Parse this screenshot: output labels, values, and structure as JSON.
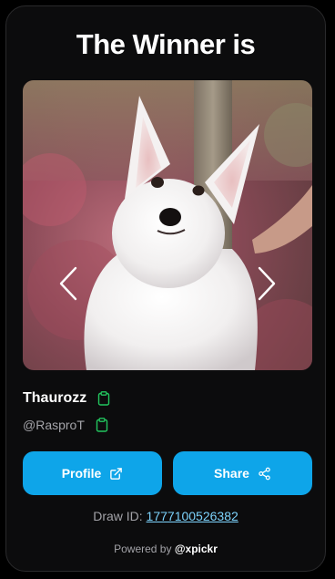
{
  "header": {
    "title": "The Winner is"
  },
  "winner": {
    "name": "Thaurozz",
    "handle": "@RasproT",
    "photo_subject": "white puppy"
  },
  "actions": {
    "profile_label": "Profile",
    "share_label": "Share"
  },
  "draw": {
    "label": "Draw ID:",
    "id": "1777100526382"
  },
  "footer": {
    "powered_by": "Powered by",
    "brand": "@xpickr"
  },
  "icons": {
    "prev": "chevron-left-icon",
    "next": "chevron-right-icon",
    "copy": "clipboard-icon",
    "external": "external-link-icon",
    "share": "share-icon"
  },
  "colors": {
    "accent": "#0ea5e9",
    "copy_icon": "#22c55e",
    "link": "#7dd3fc",
    "card_bg": "#0c0c0d"
  }
}
